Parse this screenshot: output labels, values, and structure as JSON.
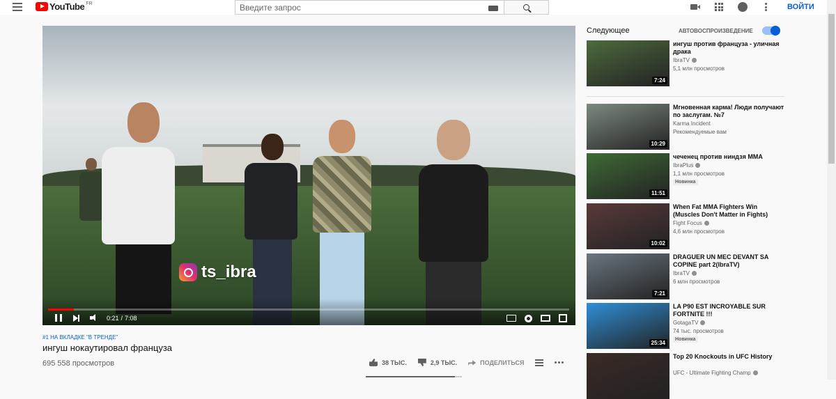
{
  "masthead": {
    "logo_text": "YouTube",
    "logo_country": "FR",
    "search_placeholder": "Введите запрос",
    "signin_label": "ВОЙТИ"
  },
  "player": {
    "watermark": "ts_ibra",
    "time_current": "0:21",
    "time_separator": "/",
    "time_total": "7:08",
    "progress_fraction": 0.049
  },
  "video": {
    "trending": "#1 НА ВКЛАДКЕ \"В ТРЕНДЕ\"",
    "title": "ингуш нокаутировал француза",
    "views": "695 558 просмотров",
    "likes": "38 ТЫС.",
    "dislikes": "2,9 ТЫС.",
    "share": "ПОДЕЛИТЬСЯ"
  },
  "sidebar": {
    "up_next": "Следующее",
    "autoplay": "АВТОВОСПРОИЗВЕДЕНИЕ",
    "autoplay_on": true,
    "items": [
      {
        "title": "ингуш против француза - уличная драка",
        "channel": "IbraTV",
        "verified": true,
        "meta": "5,1 млн просмотров",
        "badge": "",
        "duration": "7:24",
        "color": "#4d6a3e"
      },
      {
        "title": "Мгновенная карма! Люди получают по заслугам. №7",
        "channel": "Karma Incident",
        "verified": false,
        "meta": "Рекомендуемые вам",
        "badge": "",
        "duration": "10:29",
        "color": "#7d8a80"
      },
      {
        "title": "чеченец против ниндзя MMA",
        "channel": "IbraPlus",
        "verified": true,
        "meta": "1,1 млн просмотров",
        "badge": "Новинка",
        "duration": "11:51",
        "color": "#3f6a36"
      },
      {
        "title": "When Fat MMA Fighters Win (Muscles Don't Matter in Fights)",
        "channel": "Fight Focus",
        "verified": true,
        "meta": "4,6 млн просмотров",
        "badge": "",
        "duration": "10:02",
        "color": "#5a3a3a"
      },
      {
        "title": "DRAGUER UN MEC DEVANT SA COPINE part 2(IbraTV)",
        "channel": "IbraTV",
        "verified": true,
        "meta": "6 млн просмотров",
        "badge": "",
        "duration": "7:21",
        "color": "#6a7680"
      },
      {
        "title": "LA P90 EST INCROYABLE SUR FORTNITE !!!",
        "channel": "GotagaTV",
        "verified": true,
        "meta": "74 тыс. просмотров",
        "badge": "Новинка",
        "duration": "25:34",
        "color": "#2f8fd8"
      },
      {
        "title": "Top 20 Knockouts in UFC History",
        "channel": "UFC - Ultimate Fighting Champ",
        "verified": true,
        "meta": "",
        "badge": "",
        "duration": "",
        "color": "#3a2a26"
      }
    ]
  }
}
